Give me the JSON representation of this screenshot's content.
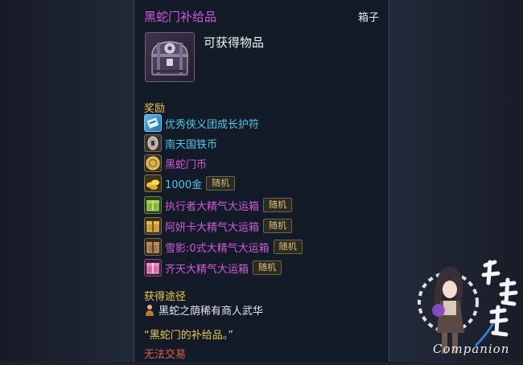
{
  "tooltip": {
    "title": "黑蛇门补给品",
    "type": "箱子",
    "item_icon": "treasure-chest-icon",
    "obtainable_label": "可获得物品",
    "rewards_heading": "奖励",
    "rewards": [
      {
        "name": "优秀侠义团成长护符",
        "color": "#4fc6e6",
        "icon": "talisman-icon",
        "tag": ""
      },
      {
        "name": "南天国铁币",
        "color": "#4fc6e6",
        "icon": "iron-coin-icon",
        "tag": ""
      },
      {
        "name": "黑蛇门币",
        "color": "#cf5ad8",
        "icon": "gold-coin-icon",
        "tag": ""
      },
      {
        "name": "1000金",
        "color": "#4fc6e6",
        "icon": "gold-ingots-icon",
        "tag": "随机"
      },
      {
        "name": "执行者大精气大运箱",
        "color": "#cf5ad8",
        "icon": "green-box-icon",
        "tag": "随机"
      },
      {
        "name": "阿妍卡大精气大运箱",
        "color": "#cf5ad8",
        "icon": "golden-box-icon",
        "tag": "随机"
      },
      {
        "name": "雪影:0式大精气大运箱",
        "color": "#cf5ad8",
        "icon": "brown-box-icon",
        "tag": "随机"
      },
      {
        "name": "齐天大精气大运箱",
        "color": "#cf5ad8",
        "icon": "pink-box-icon",
        "tag": "随机"
      }
    ],
    "source_heading": "获得途径",
    "source": {
      "icon": "merchant-icon",
      "text": "黑蛇之荫稀有商人武华"
    },
    "flavor_text": "“黑蛇门的补给品。”",
    "untradeable": "无法交易"
  },
  "watermark": {
    "text": "Companion",
    "logo_glyphs": "攻略组"
  }
}
